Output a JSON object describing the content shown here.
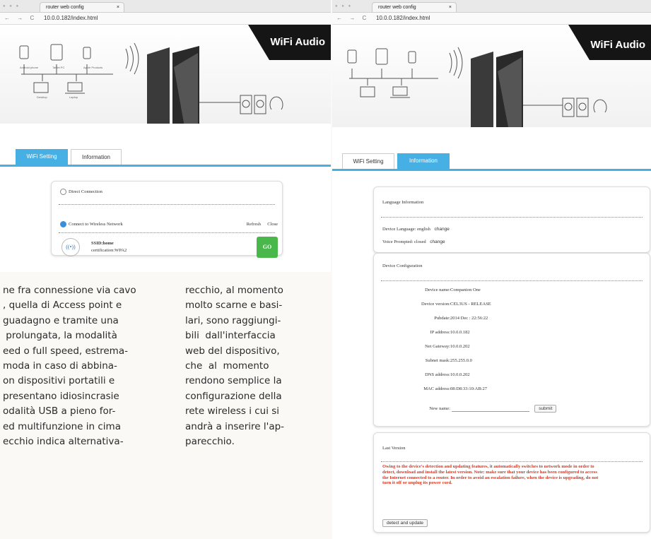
{
  "browser": {
    "tab_title": "router web config",
    "tab_close": "×",
    "nav": "← → C",
    "url": "10.0.0.182/index.html"
  },
  "banner": {
    "brand": "WiFi Audio",
    "speakers_caption": "ACTIVE SPEAKERS HEADPHONES"
  },
  "left_screen": {
    "tabs": [
      "WiFi Setting",
      "Information"
    ],
    "active_tab": 0,
    "options": {
      "direct": "Direct Connection",
      "wireless": "Connect to Wireless Network"
    },
    "refresh": "Refresh",
    "close": "Close",
    "ssid": "SSID:home",
    "cert": "certification:WPA2",
    "go": "GO"
  },
  "right_screen": {
    "tabs": [
      "WiFi Setting",
      "Information"
    ],
    "active_tab": 1,
    "language": {
      "title": "Language Information",
      "device_language": "Device Language: english",
      "voice_prompt": "Voice Prompted: closed",
      "change": "change"
    },
    "config": {
      "title": "Device Configuration",
      "rows": [
        {
          "label": "Device name:",
          "value": "Companion One"
        },
        {
          "label": "Device version:",
          "value": "CEL3US - RELEASE"
        },
        {
          "label": "Pubdate:",
          "value": "2014 Dec : 22:56:22"
        },
        {
          "label": "IP address:",
          "value": "10.0.0.182"
        },
        {
          "label": "Net Gateway:",
          "value": "10.0.0.202"
        },
        {
          "label": "Subnet mask:",
          "value": "255.255.0.0"
        },
        {
          "label": "DNS address:",
          "value": "10.0.0.202"
        },
        {
          "label": "MAC address:",
          "value": "08:D8:33:10:AB:27"
        }
      ],
      "new_name_label": "New name:",
      "submit": "submit"
    },
    "last_version": {
      "title": "Last Version",
      "warning": "Owing to the device's detection and updating features, it automatically switches to network mode in order to detect, download and install the latest version. Note: make sure that your device has been configured to access the Internet connected to a router. In order to avoid an escalation failure, when the device is upgrading, do not turn it off or unplug its power cord.",
      "button": "detect and update"
    }
  },
  "article": {
    "col1": [
      "ne fra connessione via cavo",
      ", quella di Access point e",
      "guadagno e tramite una",
      " prolungata, la modalità",
      "eed o full speed, estrema-",
      "moda in caso di abbina-",
      "on dispositivi portatili e",
      "presentano idiosincrasie",
      "odalità USB a pieno for-",
      "ed multifunzione in cima",
      "ecchio indica alternativa-"
    ],
    "col2": [
      "recchio, al momento",
      "molto scarne e basi-",
      "lari, sono raggiungi-",
      "bili  dall'interfaccia",
      "web del dispositivo,",
      "che  al  momento",
      "rendono semplice la",
      "configurazione della",
      "rete wireless i cui si",
      "andrà a inserire l'ap-",
      "parecchio."
    ]
  }
}
